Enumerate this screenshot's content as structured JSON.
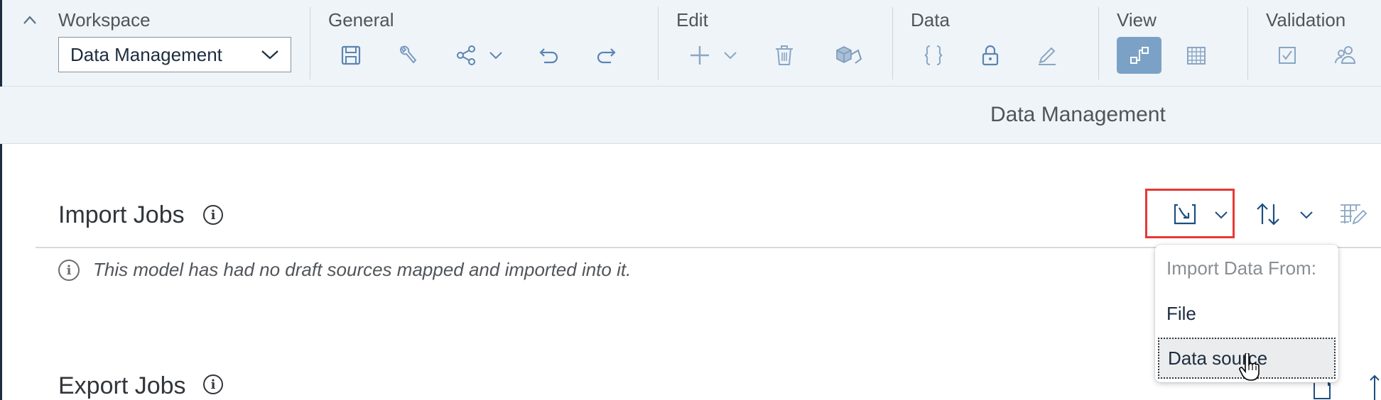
{
  "toolbar": {
    "groups": {
      "workspace": "Workspace",
      "general": "General",
      "edit": "Edit",
      "data": "Data",
      "view": "View",
      "validation": "Validation"
    },
    "workspace_select_value": "Data Management",
    "icons": {
      "collapse": "chevron-up-icon",
      "save": "save-icon",
      "settings": "wrench-icon",
      "share": "share-icon",
      "undo": "undo-icon",
      "redo": "redo-icon",
      "add": "add-icon",
      "delete": "delete-icon",
      "manage": "cubes-icon",
      "formula": "curly-braces-icon",
      "lock": "lock-icon",
      "edit": "pencil-icon",
      "data_management_view": "data-flow-icon",
      "grid_view": "grid-icon",
      "validate": "checkbox-icon",
      "users": "users-icon"
    }
  },
  "page_title": "Data Management",
  "import_section": {
    "title": "Import Jobs",
    "message": "This model has had no draft sources mapped and imported into it.",
    "menu": {
      "header": "Import Data From:",
      "items": [
        "File",
        "Data source"
      ],
      "hovered": "Data source"
    }
  },
  "export_section": {
    "title": "Export Jobs"
  },
  "colors": {
    "toolbar_bg": "#eff4f9",
    "accent_blue": "#7ba2c6",
    "icon_blue": "#5b85b0",
    "highlight_red": "#e53935",
    "text": "#32363a"
  }
}
